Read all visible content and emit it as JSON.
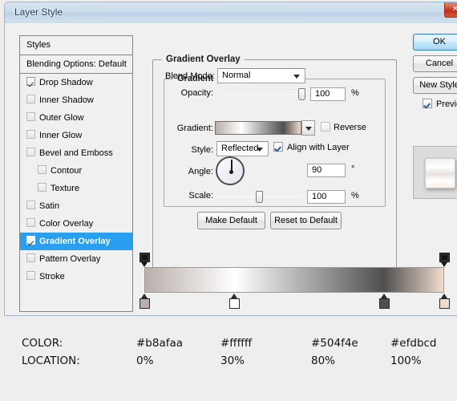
{
  "window": {
    "title": "Layer Style",
    "close_label": "✕"
  },
  "styles_panel": {
    "header": "Styles",
    "blending_options": "Blending Options: Default",
    "items": [
      {
        "label": "Drop Shadow",
        "checked": true,
        "indent": false,
        "selected": false,
        "dim": false
      },
      {
        "label": "Inner Shadow",
        "checked": false,
        "indent": false,
        "selected": false,
        "dim": true
      },
      {
        "label": "Outer Glow",
        "checked": false,
        "indent": false,
        "selected": false,
        "dim": true
      },
      {
        "label": "Inner Glow",
        "checked": false,
        "indent": false,
        "selected": false,
        "dim": true
      },
      {
        "label": "Bevel and Emboss",
        "checked": false,
        "indent": false,
        "selected": false,
        "dim": true
      },
      {
        "label": "Contour",
        "checked": false,
        "indent": true,
        "selected": false,
        "dim": true
      },
      {
        "label": "Texture",
        "checked": false,
        "indent": true,
        "selected": false,
        "dim": true
      },
      {
        "label": "Satin",
        "checked": false,
        "indent": false,
        "selected": false,
        "dim": true
      },
      {
        "label": "Color Overlay",
        "checked": false,
        "indent": false,
        "selected": false,
        "dim": true
      },
      {
        "label": "Gradient Overlay",
        "checked": true,
        "indent": false,
        "selected": true,
        "dim": false
      },
      {
        "label": "Pattern Overlay",
        "checked": false,
        "indent": false,
        "selected": false,
        "dim": true
      },
      {
        "label": "Stroke",
        "checked": false,
        "indent": false,
        "selected": false,
        "dim": true
      }
    ]
  },
  "gradient_overlay": {
    "group_title": "Gradient Overlay",
    "subgroup_title": "Gradient",
    "blend_mode": {
      "label": "Blend Mode:",
      "value": "Normal"
    },
    "opacity": {
      "label": "Opacity:",
      "value": "100",
      "unit": "%",
      "percent": 100
    },
    "gradient": {
      "label": "Gradient:",
      "reverse_label": "Reverse",
      "reverse_checked": false
    },
    "style": {
      "label": "Style:",
      "value": "Reflected",
      "align_label": "Align with Layer",
      "align_checked": true
    },
    "angle": {
      "label": "Angle:",
      "value": "90",
      "unit": "°",
      "degrees": 90
    },
    "scale": {
      "label": "Scale:",
      "value": "100",
      "unit": "%",
      "percent": 50
    },
    "make_default": "Make Default",
    "reset_default": "Reset to Default"
  },
  "right_buttons": {
    "ok": "OK",
    "cancel": "Cancel",
    "new_style": "New Style",
    "preview_label": "Preview",
    "preview_checked": true
  },
  "gradient_editor": {
    "opacity_stops": [
      {
        "position": 0
      },
      {
        "position": 100
      }
    ],
    "color_stops": [
      {
        "position": 0,
        "color": "#b8afaa"
      },
      {
        "position": 30,
        "color": "#ffffff"
      },
      {
        "position": 80,
        "color": "#504f4e"
      },
      {
        "position": 100,
        "color": "#efdbcd"
      }
    ],
    "css_gradient": "linear-gradient(to right, #b8afaa 0%, #ffffff 30%, #504f4e 80%, #efdbcd 100%)"
  },
  "caption": {
    "row_labels": [
      "COLOR:",
      "LOCATION:"
    ],
    "colors": [
      "#b8afaa",
      "#ffffff",
      "#504f4e",
      "#efdbcd"
    ],
    "locations": [
      "0%",
      "30%",
      "80%",
      "100%"
    ]
  }
}
